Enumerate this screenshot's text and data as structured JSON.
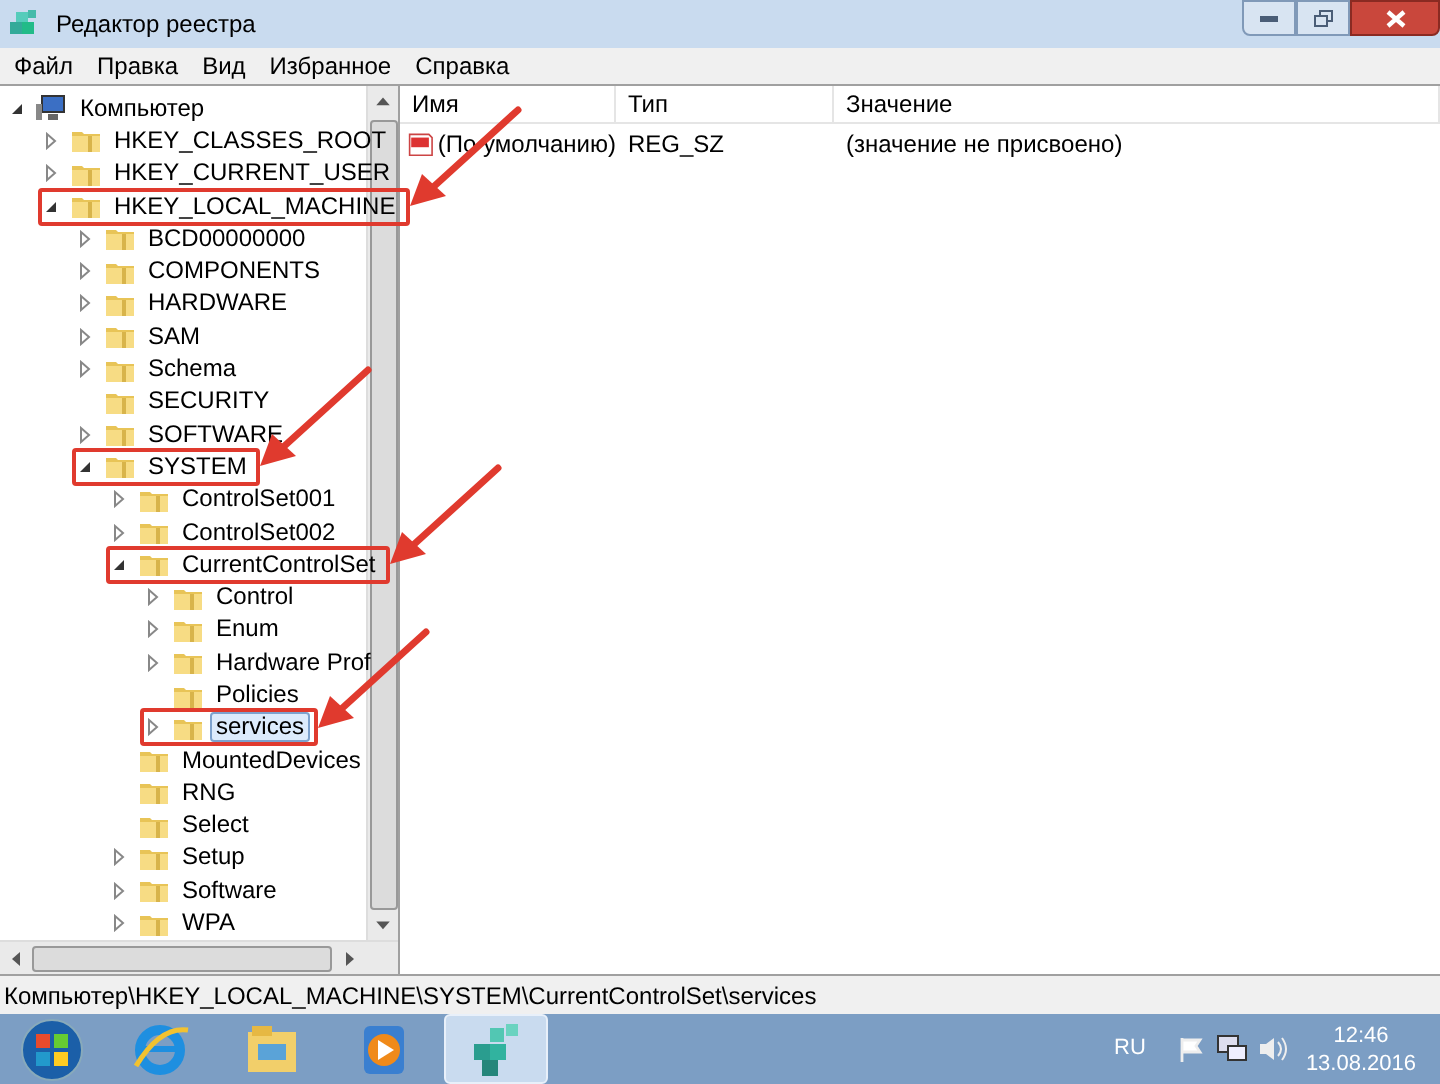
{
  "window": {
    "title": "Редактор реестра"
  },
  "menu": [
    "Файл",
    "Правка",
    "Вид",
    "Избранное",
    "Справка"
  ],
  "tree": [
    {
      "label": "Компьютер",
      "kind": "computer",
      "expanded": true,
      "selected": false,
      "highlighted": false,
      "children": [
        {
          "label": "HKEY_CLASSES_ROOT",
          "expanded": false,
          "selected": false,
          "highlighted": false
        },
        {
          "label": "HKEY_CURRENT_USER",
          "expanded": false,
          "selected": false,
          "highlighted": false
        },
        {
          "label": "HKEY_LOCAL_MACHINE",
          "expanded": true,
          "selected": false,
          "highlighted": true,
          "children": [
            {
              "label": "BCD00000000",
              "expanded": false,
              "selected": false,
              "highlighted": false
            },
            {
              "label": "COMPONENTS",
              "expanded": false,
              "selected": false,
              "highlighted": false
            },
            {
              "label": "HARDWARE",
              "expanded": false,
              "selected": false,
              "highlighted": false
            },
            {
              "label": "SAM",
              "expanded": false,
              "selected": false,
              "highlighted": false
            },
            {
              "label": "Schema",
              "expanded": false,
              "selected": false,
              "highlighted": false
            },
            {
              "label": "SECURITY",
              "selected": false,
              "highlighted": false
            },
            {
              "label": "SOFTWARE",
              "expanded": false,
              "selected": false,
              "highlighted": false
            },
            {
              "label": "SYSTEM",
              "expanded": true,
              "selected": false,
              "highlighted": true,
              "children": [
                {
                  "label": "ControlSet001",
                  "expanded": false,
                  "selected": false,
                  "highlighted": false
                },
                {
                  "label": "ControlSet002",
                  "expanded": false,
                  "selected": false,
                  "highlighted": false
                },
                {
                  "label": "CurrentControlSet",
                  "expanded": true,
                  "selected": false,
                  "highlighted": true,
                  "children": [
                    {
                      "label": "Control",
                      "expanded": false,
                      "selected": false,
                      "highlighted": false
                    },
                    {
                      "label": "Enum",
                      "expanded": false,
                      "selected": false,
                      "highlighted": false
                    },
                    {
                      "label": "Hardware Prof",
                      "expanded": false,
                      "selected": false,
                      "highlighted": false
                    },
                    {
                      "label": "Policies",
                      "selected": false,
                      "highlighted": false
                    },
                    {
                      "label": "services",
                      "expanded": false,
                      "selected": true,
                      "highlighted": true
                    }
                  ]
                },
                {
                  "label": "MountedDevices",
                  "selected": false,
                  "highlighted": false
                },
                {
                  "label": "RNG",
                  "selected": false,
                  "highlighted": false
                },
                {
                  "label": "Select",
                  "selected": false,
                  "highlighted": false
                },
                {
                  "label": "Setup",
                  "expanded": false,
                  "selected": false,
                  "highlighted": false
                },
                {
                  "label": "Software",
                  "expanded": false,
                  "selected": false,
                  "highlighted": false
                },
                {
                  "label": "WPA",
                  "expanded": false,
                  "selected": false,
                  "highlighted": false
                }
              ]
            }
          ]
        }
      ]
    }
  ],
  "table": {
    "columns": [
      "Имя",
      "Тип",
      "Значение"
    ],
    "rows": [
      {
        "name": "(По умолчанию)",
        "type": "REG_SZ",
        "value": "(значение не присвоено)"
      }
    ]
  },
  "status_bar": "Компьютер\\HKEY_LOCAL_MACHINE\\SYSTEM\\CurrentControlSet\\services",
  "taskbar": {
    "apps": [
      {
        "kind": "ie",
        "active": false
      },
      {
        "kind": "explorer",
        "active": false
      },
      {
        "kind": "media",
        "active": false
      },
      {
        "kind": "regedit",
        "active": true
      }
    ],
    "language": "RU",
    "time": "12:46",
    "date": "13.08.2016"
  }
}
